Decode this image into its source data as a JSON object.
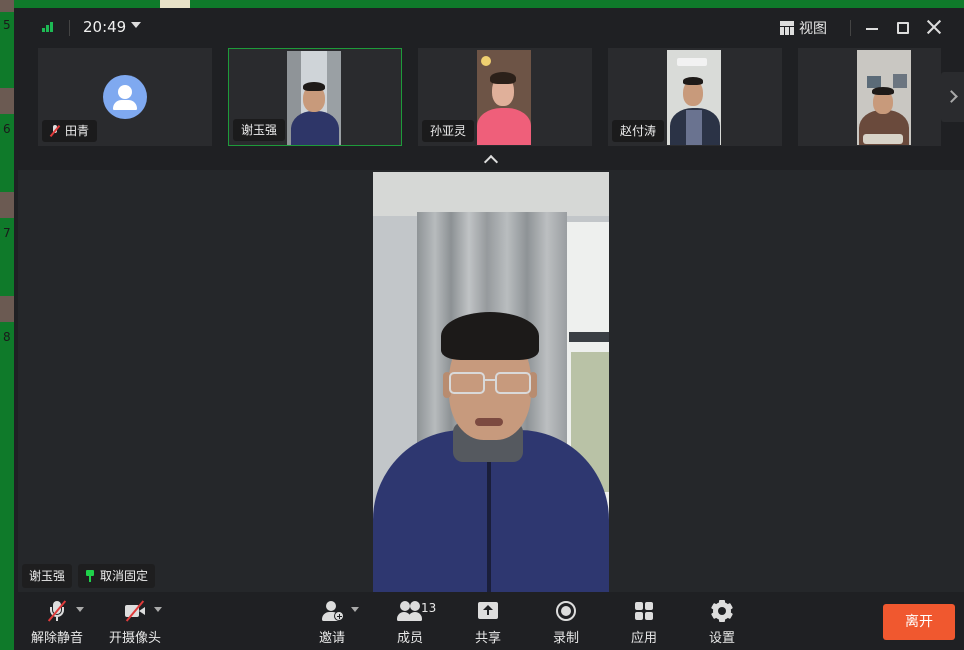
{
  "titlebar": {
    "time": "20:49",
    "view_label": "视图"
  },
  "participants": [
    {
      "name": "田青",
      "muted": true,
      "video": false
    },
    {
      "name": "谢玉强",
      "muted": false,
      "video": true,
      "active": true
    },
    {
      "name": "孙亚灵",
      "muted": false,
      "video": true
    },
    {
      "name": "赵付涛",
      "muted": false,
      "video": true
    },
    {
      "name": "",
      "muted": false,
      "video": true
    }
  ],
  "stage": {
    "speaker_name": "谢玉强",
    "unpin_label": "取消固定"
  },
  "toolbar": {
    "unmute_label": "解除静音",
    "camera_label": "开摄像头",
    "invite_label": "邀请",
    "members_label": "成员",
    "members_count": "13",
    "share_label": "共享",
    "record_label": "录制",
    "apps_label": "应用",
    "settings_label": "设置",
    "leave_label": "离开"
  },
  "desktop": {
    "side_numbers": [
      "5",
      "6",
      "7",
      "8"
    ]
  },
  "colors": {
    "accent_green": "#1e9b3a",
    "leave_orange": "#f0582f",
    "desktop_green": "#0f7a2a"
  }
}
